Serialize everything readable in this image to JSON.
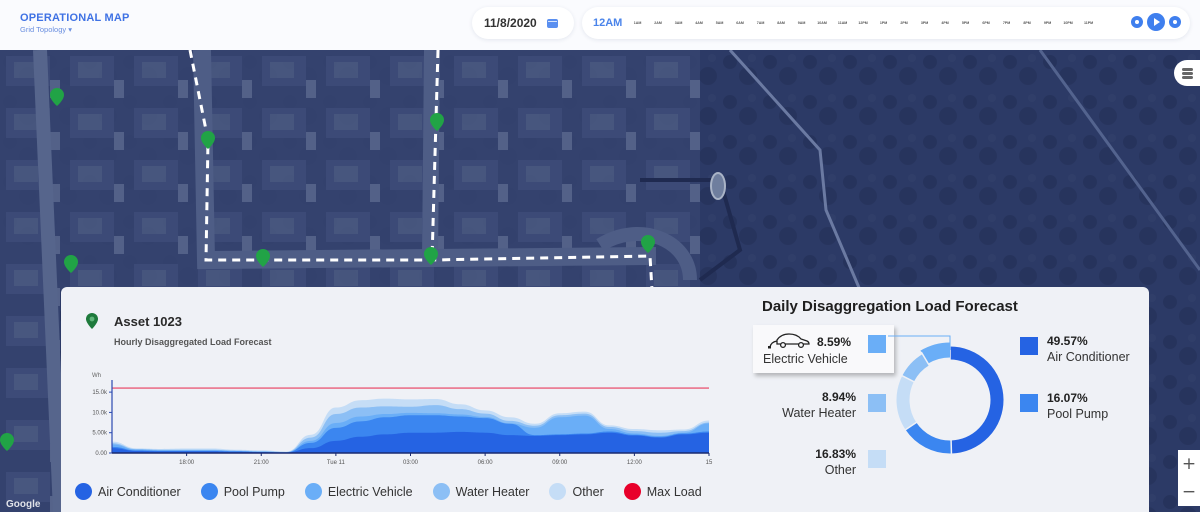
{
  "header": {
    "title": "OPERATIONAL MAP",
    "subtitle": "Grid Topology ▾",
    "date": "11/8/2020",
    "calendar_icon": "calendar-icon",
    "timeline": {
      "current": "12AM",
      "hours": [
        "1AM",
        "2AM",
        "3AM",
        "4AM",
        "5AM",
        "6AM",
        "7AM",
        "8AM",
        "9AM",
        "10AM",
        "11AM",
        "12PM",
        "1PM",
        "2PM",
        "3PM",
        "4PM",
        "5PM",
        "6PM",
        "7PM",
        "8PM",
        "9PM",
        "10PM",
        "11PM"
      ]
    },
    "player_icons": [
      "previous-icon",
      "play-icon",
      "next-icon"
    ]
  },
  "map": {
    "layers_icon": "layers-icon",
    "zoom_in": "+",
    "zoom_out": "−",
    "attribution": "Google"
  },
  "asset": {
    "title": "Asset 1023",
    "subtitle": "Hourly Disaggregated Load Forecast",
    "pin_icon": "map-pin-icon"
  },
  "colors": {
    "air_conditioner": "#2563e3",
    "pool_pump": "#3b86f0",
    "electric_vehicle": "#6aaef7",
    "water_heater": "#8cbff5",
    "other": "#c5ddf6",
    "max_load": "#e8002a"
  },
  "chart_data": [
    {
      "type": "area",
      "title": "Hourly Disaggregated Load Forecast",
      "ylabel": "Wh",
      "xlabel": "",
      "ylim": [
        0,
        17000
      ],
      "yticks": [
        "0.00",
        "5.00k",
        "10.0k",
        "15.0k"
      ],
      "ytick_values": [
        0,
        5000,
        10000,
        15000
      ],
      "xticks": [
        "18:00",
        "21:00",
        "Tue 11",
        "03:00",
        "06:00",
        "09:00",
        "12:00",
        "15"
      ],
      "xtick_hours": [
        18,
        21,
        24,
        27,
        30,
        33,
        36,
        39
      ],
      "x_hours": [
        15,
        16,
        17,
        18,
        19,
        20,
        21,
        22,
        23,
        24,
        25,
        26,
        27,
        28,
        29,
        30,
        31,
        32,
        33,
        34,
        35,
        36,
        37,
        38,
        39
      ],
      "max_load": 16000,
      "stacked": true,
      "series": [
        {
          "name": "Air Conditioner",
          "values": [
            1200,
            500,
            400,
            400,
            400,
            300,
            200,
            100,
            1200,
            3000,
            4000,
            4600,
            5000,
            5000,
            5200,
            5000,
            4400,
            4200,
            4400,
            4600,
            5000,
            4300,
            3800,
            4600,
            5000
          ]
        },
        {
          "name": "Pool Pump",
          "values": [
            300,
            150,
            100,
            100,
            100,
            100,
            50,
            50,
            1300,
            3200,
            3800,
            4200,
            4300,
            4300,
            3800,
            3600,
            2800,
            200,
            200,
            200,
            300,
            200,
            200,
            200,
            300
          ]
        },
        {
          "name": "Electric Vehicle",
          "values": [
            600,
            200,
            200,
            200,
            200,
            100,
            100,
            50,
            500,
            1200,
            1200,
            800,
            600,
            500,
            500,
            300,
            100,
            1800,
            4200,
            4400,
            600,
            300,
            200,
            200,
            2000
          ]
        },
        {
          "name": "Water Heater",
          "values": [
            300,
            100,
            100,
            100,
            100,
            100,
            100,
            50,
            800,
            2200,
            2200,
            1900,
            1500,
            2000,
            1300,
            800,
            600,
            500,
            500,
            500,
            500,
            600,
            800,
            400,
            200
          ]
        },
        {
          "name": "Other",
          "values": [
            400,
            200,
            200,
            300,
            300,
            200,
            200,
            100,
            700,
            1600,
            1800,
            1900,
            1800,
            1500,
            1200,
            800,
            900,
            500,
            500,
            500,
            400,
            500,
            600,
            400,
            500
          ]
        }
      ],
      "legend": [
        "Air Conditioner",
        "Pool Pump",
        "Electric Vehicle",
        "Water Heater",
        "Other",
        "Max Load"
      ],
      "legend_position": "bottom"
    },
    {
      "type": "pie",
      "title": "Daily Disaggregation Load Forecast",
      "donut": true,
      "slices": [
        {
          "name": "Air Conditioner",
          "value": 49.57,
          "label": "49.57%"
        },
        {
          "name": "Pool Pump",
          "value": 16.07,
          "label": "16.07%"
        },
        {
          "name": "Other",
          "value": 16.83,
          "label": "16.83%"
        },
        {
          "name": "Water Heater",
          "value": 8.94,
          "label": "8.94%"
        },
        {
          "name": "Electric Vehicle",
          "value": 8.59,
          "label": "8.59%"
        }
      ],
      "highlighted": "Electric Vehicle",
      "highlight_icon": "electric-car-icon"
    }
  ]
}
